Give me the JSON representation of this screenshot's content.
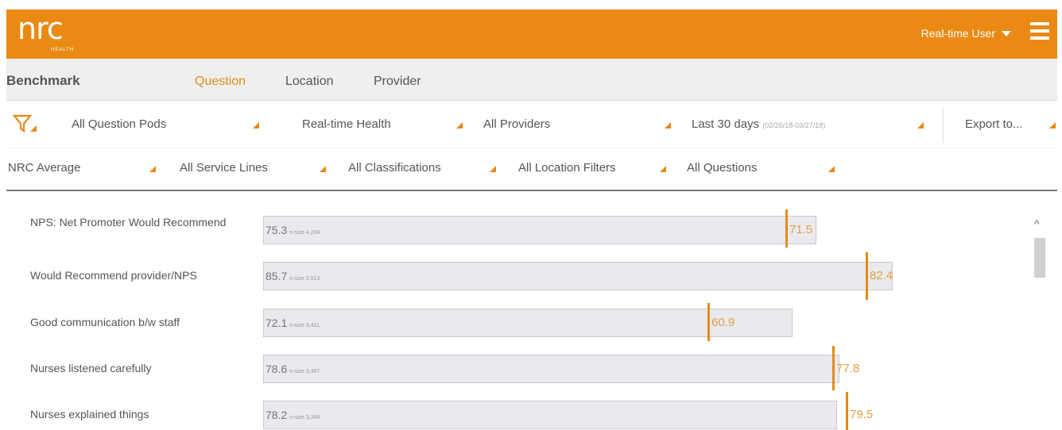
{
  "header": {
    "logo": "nrc",
    "logo_sub": "HEALTH",
    "user": "Real-time User"
  },
  "nav": {
    "title": "Benchmark",
    "tabs": [
      "Question",
      "Location",
      "Provider"
    ],
    "active_tab": "Question"
  },
  "filters_row1": {
    "question_pods": "All Question Pods",
    "health": "Real-time Health",
    "providers": "All Providers",
    "date_label": "Last 30 days",
    "date_range": "(02/26/18-03/27/18)",
    "export": "Export to..."
  },
  "filters_row2": {
    "average": "NRC Average",
    "service_lines": "All Service Lines",
    "classifications": "All Classifications",
    "location_filters": "All Location Filters",
    "questions": "All Questions"
  },
  "rows": [
    {
      "label": "NPS: Net Promoter Would Recommend",
      "value": "75.3",
      "nsize": "n-size 4,204",
      "benchmark": "71.5"
    },
    {
      "label": "Would Recommend provider/NPS",
      "value": "85.7",
      "nsize": "n-size 3,513",
      "benchmark": "82.4"
    },
    {
      "label": "Good communication b/w staff",
      "value": "72.1",
      "nsize": "n-size 3,411",
      "benchmark": "60.9"
    },
    {
      "label": "Nurses listened carefully",
      "value": "78.6",
      "nsize": "n-size 3,367",
      "benchmark": "77.8"
    },
    {
      "label": "Nurses explained things",
      "value": "78.2",
      "nsize": "n-size 3,344",
      "benchmark": "79.5"
    }
  ],
  "colors": {
    "accent": "#ea8a14",
    "bar_fill": "#eaeaee"
  },
  "icons": [
    "filter-icon",
    "hamburger-menu-icon",
    "caret-down-icon",
    "scroll-up-icon"
  ]
}
